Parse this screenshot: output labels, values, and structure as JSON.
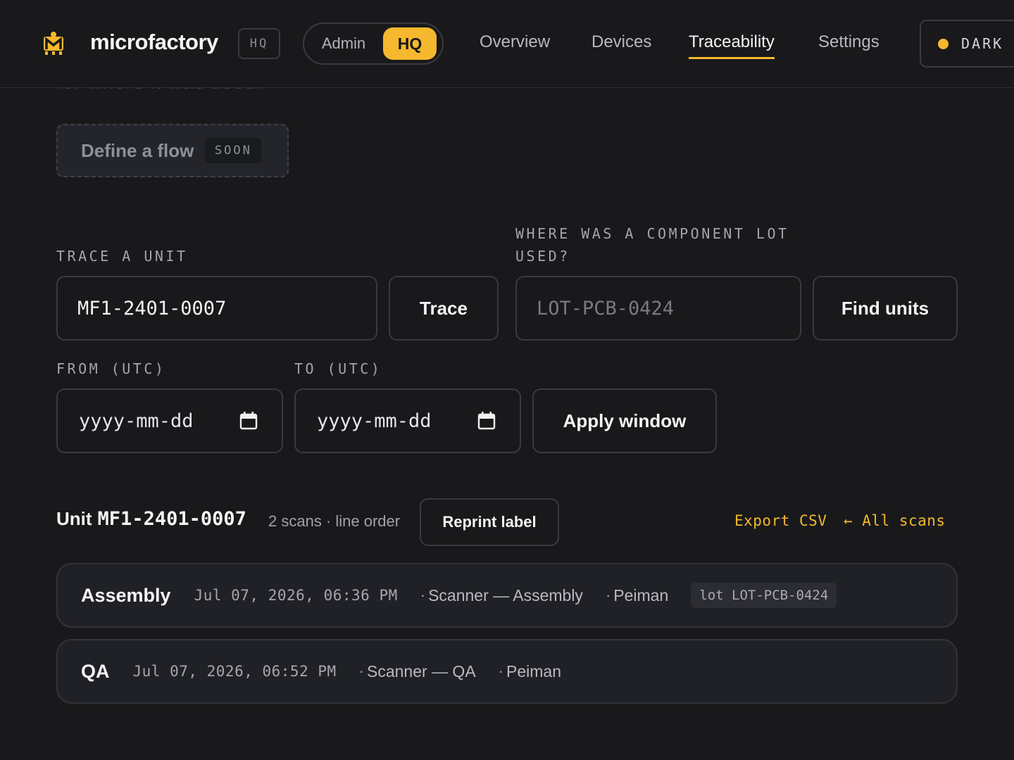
{
  "header": {
    "brand": "microfactory",
    "brand_badge": "HQ",
    "mode": {
      "admin": "Admin",
      "hq": "HQ"
    },
    "nav": [
      {
        "label": "Overview"
      },
      {
        "label": "Devices"
      },
      {
        "label": "Traceability"
      },
      {
        "label": "Settings"
      }
    ],
    "theme_label": "DARK",
    "accent": "#f5b82e"
  },
  "ghost_text": "for where it was used.",
  "define_flow": {
    "label": "Define a flow",
    "badge": "SOON"
  },
  "trace_unit": {
    "label": "TRACE A UNIT",
    "value": "MF1-2401-0007",
    "button": "Trace"
  },
  "component_lot": {
    "label_line1": "WHERE WAS A COMPONENT LOT",
    "label_line2": "USED?",
    "placeholder": "LOT-PCB-0424",
    "button": "Find units"
  },
  "window": {
    "from_label": "FROM (UTC)",
    "to_label": "TO (UTC)",
    "from_value": "yyyy-mm-dd",
    "to_value": "yyyy-mm-dd",
    "button": "Apply window"
  },
  "unit": {
    "title_prefix": "Unit",
    "id": "MF1-2401-0007",
    "meta": "2 scans · line order",
    "reprint": "Reprint label",
    "export": "Export CSV",
    "back": "← All scans"
  },
  "scans": [
    {
      "stage": "Assembly",
      "time": "Jul 07, 2026, 06:36 PM",
      "device": "Scanner — Assembly",
      "user": "Peiman",
      "lot": "lot LOT-PCB-0424"
    },
    {
      "stage": "QA",
      "time": "Jul 07, 2026, 06:52 PM",
      "device": "Scanner — QA",
      "user": "Peiman"
    }
  ]
}
